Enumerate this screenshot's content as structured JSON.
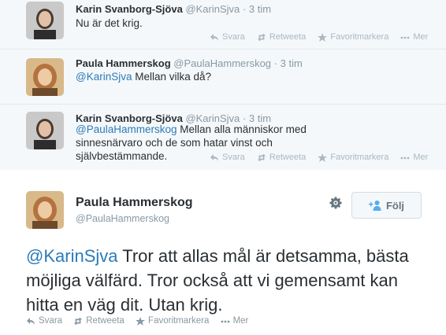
{
  "conversation": [
    {
      "name": "Karin Svanborg-Sjöva",
      "handle": "@KarinSjva",
      "dot": "·",
      "time": "3 tim",
      "mention": "",
      "text": "Nu är det krig."
    },
    {
      "name": "Paula Hammerskog",
      "handle": "@PaulaHammerskog",
      "dot": "·",
      "time": "3 tim",
      "mention": "@KarinSjva",
      "text": " Mellan vilka då?"
    },
    {
      "name": "Karin Svanborg-Sjöva",
      "handle": "@KarinSjva",
      "dot": "·",
      "time": "3 tim",
      "mention": "@PaulaHammerskog",
      "text": " Mellan alla människor med sinnesnärvaro och de som hatar vinst och självbestämmande."
    }
  ],
  "actions": {
    "reply": "Svara",
    "retweet": "Retweeta",
    "favorite": "Favoritmarkera",
    "more": "Mer"
  },
  "main": {
    "name": "Paula Hammerskog",
    "handle": "@PaulaHammerskog",
    "follow_label": "Följ",
    "mention": "@KarinSjva",
    "text": " Tror att allas mål är detsamma, bästa möjliga välfärd. Tror också att vi gemensamt kan hitta en väg dit. Utan krig."
  },
  "colors": {
    "link": "#2b7bb9",
    "muted": "#8899a6",
    "action_icon": "#aab8c2",
    "conversation_bg": "#f5f8fa"
  },
  "icons": [
    "reply-icon",
    "retweet-icon",
    "favorite-star-icon",
    "more-dots-icon",
    "gear-icon",
    "add-user-icon"
  ]
}
